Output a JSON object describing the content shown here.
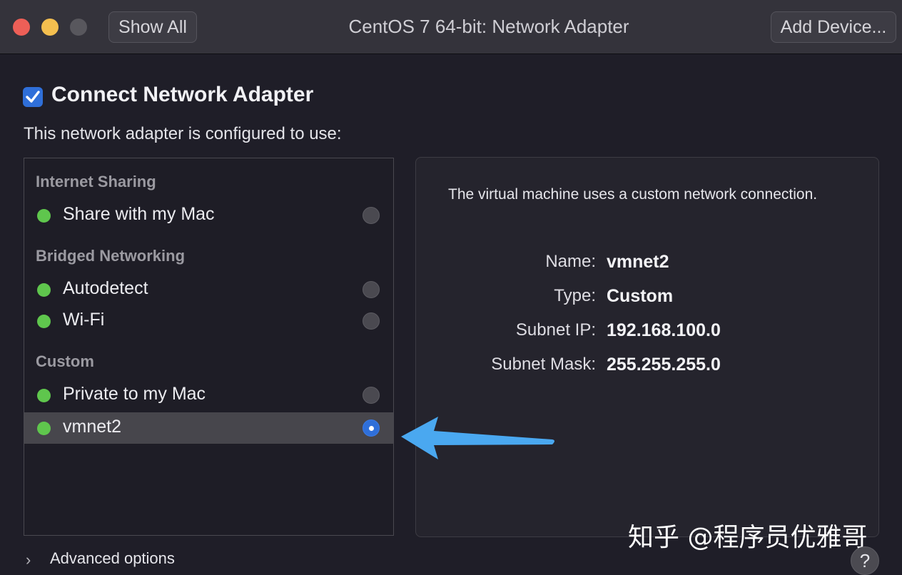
{
  "window": {
    "title": "CentOS 7 64-bit: Network Adapter",
    "show_all_label": "Show All",
    "add_device_label": "Add Device..."
  },
  "header": {
    "connect_label": "Connect Network Adapter",
    "connect_checked": true,
    "subheading": "This network adapter is configured to use:"
  },
  "list": {
    "groups": [
      {
        "label": "Internet Sharing"
      },
      {
        "label": "Bridged Networking"
      },
      {
        "label": "Custom"
      }
    ],
    "items": [
      {
        "label": "Share with my Mac",
        "status": "green",
        "selected": false
      },
      {
        "label": "Autodetect",
        "status": "green",
        "selected": false
      },
      {
        "label": "Wi-Fi",
        "status": "green",
        "selected": false
      },
      {
        "label": "Private to my Mac",
        "status": "green",
        "selected": false
      },
      {
        "label": "vmnet2",
        "status": "green",
        "selected": true
      }
    ]
  },
  "info": {
    "description": "The virtual machine uses a custom network connection.",
    "fields": [
      {
        "key": "Name:",
        "value": "vmnet2"
      },
      {
        "key": "Type:",
        "value": "Custom"
      },
      {
        "key": "Subnet IP:",
        "value": "192.168.100.0"
      },
      {
        "key": "Subnet Mask:",
        "value": "255.255.255.0"
      }
    ]
  },
  "footer": {
    "advanced_label": "Advanced options",
    "help_label": "?"
  },
  "watermark": "知乎 @程序员优雅哥",
  "colors": {
    "accent": "#2f6fd9",
    "status_green": "#5fc64d",
    "arrow": "#4aa8f0"
  }
}
